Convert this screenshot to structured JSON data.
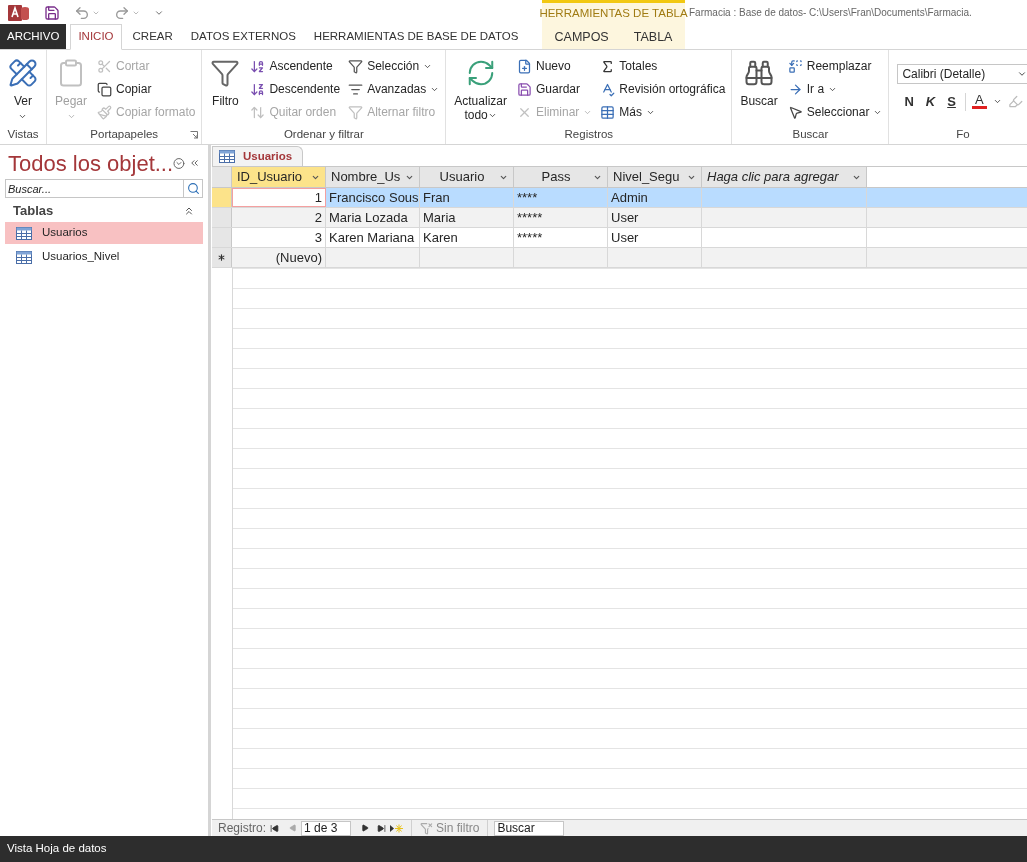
{
  "window": {
    "title": "Farmacia : Base de datos- C:\\Users\\Fran\\Documents\\Farmacia."
  },
  "tabs": [
    {
      "label": "ARCHIVO",
      "kind": "file",
      "selected": false
    },
    {
      "label": "INICIO",
      "kind": "normal",
      "selected": true
    },
    {
      "label": "CREAR",
      "kind": "normal",
      "selected": false
    },
    {
      "label": "DATOS EXTERNOS",
      "kind": "normal",
      "selected": false
    },
    {
      "label": "HERRAMIENTAS DE BASE DE DATOS",
      "kind": "normal",
      "selected": false
    }
  ],
  "context_tabs": {
    "title": "HERRAMIENTAS DE TABLA",
    "tabs": [
      {
        "label": "CAMPOS",
        "selected": false
      },
      {
        "label": "TABLA",
        "selected": false
      }
    ]
  },
  "ribbon": [
    {
      "label": "Vistas",
      "launcher": false,
      "columns": [
        {
          "kind": "large",
          "lines": [
            "Ver"
          ],
          "dropdown": true,
          "disabled": false
        }
      ]
    },
    {
      "label": "Portapapeles",
      "launcher": true,
      "columns": [
        {
          "kind": "large",
          "lines": [
            "Pegar"
          ],
          "dropdown": true,
          "disabled": true
        },
        {
          "kind": "stack",
          "items": [
            {
              "label": "Cortar",
              "disabled": true,
              "dropdown": false
            },
            {
              "label": "Copiar",
              "disabled": false,
              "dropdown": false
            },
            {
              "label": "Copiar formato",
              "disabled": true,
              "dropdown": false
            }
          ]
        }
      ]
    },
    {
      "label": "Ordenar y filtrar",
      "launcher": false,
      "columns": [
        {
          "kind": "large",
          "lines": [
            "Filtro"
          ],
          "dropdown": false,
          "disabled": false
        },
        {
          "kind": "stack",
          "items": [
            {
              "label": "Ascendente",
              "disabled": false,
              "dropdown": false
            },
            {
              "label": "Descendente",
              "disabled": false,
              "dropdown": false
            },
            {
              "label": "Quitar orden",
              "disabled": true,
              "dropdown": false
            }
          ]
        },
        {
          "kind": "stack",
          "items": [
            {
              "label": "Selección",
              "disabled": false,
              "dropdown": true
            },
            {
              "label": "Avanzadas",
              "disabled": false,
              "dropdown": true
            },
            {
              "label": "Alternar filtro",
              "disabled": true,
              "dropdown": false
            }
          ]
        }
      ]
    },
    {
      "label": "Registros",
      "launcher": false,
      "columns": [
        {
          "kind": "large",
          "lines": [
            "Actualizar",
            "todo"
          ],
          "dropdown": true,
          "disabled": false
        },
        {
          "kind": "stack",
          "items": [
            {
              "label": "Nuevo",
              "disabled": false,
              "dropdown": false
            },
            {
              "label": "Guardar",
              "disabled": false,
              "dropdown": false
            },
            {
              "label": "Eliminar",
              "disabled": true,
              "dropdown": true
            }
          ]
        },
        {
          "kind": "stack",
          "items": [
            {
              "label": "Totales",
              "disabled": false,
              "dropdown": false
            },
            {
              "label": "Revisión ortográfica",
              "disabled": false,
              "dropdown": false
            },
            {
              "label": "Más",
              "disabled": false,
              "dropdown": true
            }
          ]
        }
      ]
    },
    {
      "label": "Buscar",
      "launcher": false,
      "columns": [
        {
          "kind": "large",
          "lines": [
            "Buscar"
          ],
          "dropdown": false,
          "disabled": false
        },
        {
          "kind": "stack",
          "items": [
            {
              "label": "Reemplazar",
              "disabled": false,
              "dropdown": false
            },
            {
              "label": "Ir a",
              "disabled": false,
              "dropdown": true
            },
            {
              "label": "Seleccionar",
              "disabled": false,
              "dropdown": true
            }
          ]
        }
      ]
    },
    {
      "label": "Fo",
      "columns": [
        {
          "kind": "font",
          "font": "Calibri (Detalle)",
          "buttons": [
            "N",
            "K",
            "S",
            "A"
          ]
        }
      ]
    }
  ],
  "navigation_pane": {
    "title": "Todos los objet...",
    "search": {
      "placeholder": "Buscar..."
    },
    "sections": [
      {
        "label": "Tablas",
        "expanded": true,
        "items": [
          {
            "label": "Usuarios",
            "selected": true
          },
          {
            "label": "Usuarios_Nivel",
            "selected": false
          }
        ]
      }
    ]
  },
  "document_tabs": [
    {
      "label": "Usuarios",
      "selected": true
    }
  ],
  "table": {
    "columns": [
      {
        "label": "ID_Usuario",
        "kind": "field",
        "selected": true
      },
      {
        "label": "Nombre_Us",
        "kind": "field",
        "selected": false
      },
      {
        "label": "Usuario",
        "kind": "field",
        "selected": false
      },
      {
        "label": "Pass",
        "kind": "field",
        "selected": false
      },
      {
        "label": "Nivel_Segu",
        "kind": "field",
        "selected": false
      },
      {
        "label": "Haga clic para agregar",
        "kind": "add",
        "selected": false
      }
    ],
    "rows": [
      {
        "kind": "record",
        "selected": true,
        "cells": [
          "1",
          "Francisco Sous",
          "Fran",
          "****",
          "Admin"
        ]
      },
      {
        "kind": "record",
        "selected": false,
        "cells": [
          "2",
          "Maria Lozada",
          "Maria",
          "*****",
          "User"
        ]
      },
      {
        "kind": "record",
        "selected": false,
        "cells": [
          "3",
          "Karen Mariana",
          "Karen",
          "*****",
          "User"
        ]
      },
      {
        "kind": "new",
        "selected": false,
        "cells": [
          "(Nuevo)"
        ]
      }
    ]
  },
  "record_navigator": {
    "label": "Registro:",
    "position": "1 de 3",
    "filter": "Sin filtro",
    "search": {
      "placeholder": "Buscar"
    }
  },
  "status_bar": "Vista Hoja de datos"
}
